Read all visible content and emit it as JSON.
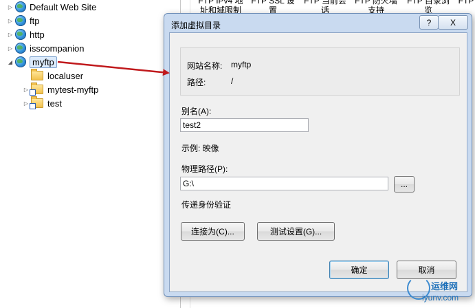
{
  "tree": {
    "nodes": [
      {
        "label": "Default Web Site",
        "icon": "globe-icon"
      },
      {
        "label": "ftp",
        "icon": "globe-icon"
      },
      {
        "label": "http",
        "icon": "globe-icon"
      },
      {
        "label": "isscompanion",
        "icon": "globe-icon"
      },
      {
        "label": "myftp",
        "icon": "globe-icon"
      },
      {
        "label": "localuser",
        "icon": "folder-icon"
      },
      {
        "label": "mytest-myftp",
        "icon": "virtual-directory-icon"
      },
      {
        "label": "test",
        "icon": "virtual-directory-icon"
      }
    ]
  },
  "background_tabs": [
    "FTP IPv4 地址和域限制",
    "FTP SSL 设置",
    "FTP 当前会话",
    "FTP 防火墙支持",
    "FTP 目录浏览",
    "FTP"
  ],
  "dialog": {
    "title": "添加虚拟目录",
    "help_label": "?",
    "close_label": "X",
    "site_name_label": "网站名称:",
    "site_name_value": "myftp",
    "path_label": "路径:",
    "path_value": "/",
    "alias_label": "别名(A):",
    "alias_value": "test2",
    "example_text": "示例: 映像",
    "physical_path_label": "物理路径(P):",
    "physical_path_value": "G:\\",
    "browse_label": "...",
    "pass_through_auth_label": "传递身份验证",
    "connect_as_label": "连接为(C)...",
    "test_settings_label": "测试设置(G)...",
    "ok_label": "确定",
    "cancel_label": "取消"
  },
  "watermark": {
    "line1": "运维网",
    "line2": "iyunv.com"
  },
  "colors": {
    "arrow": "#c0191c",
    "dialog_frame": "#c9daf0"
  }
}
